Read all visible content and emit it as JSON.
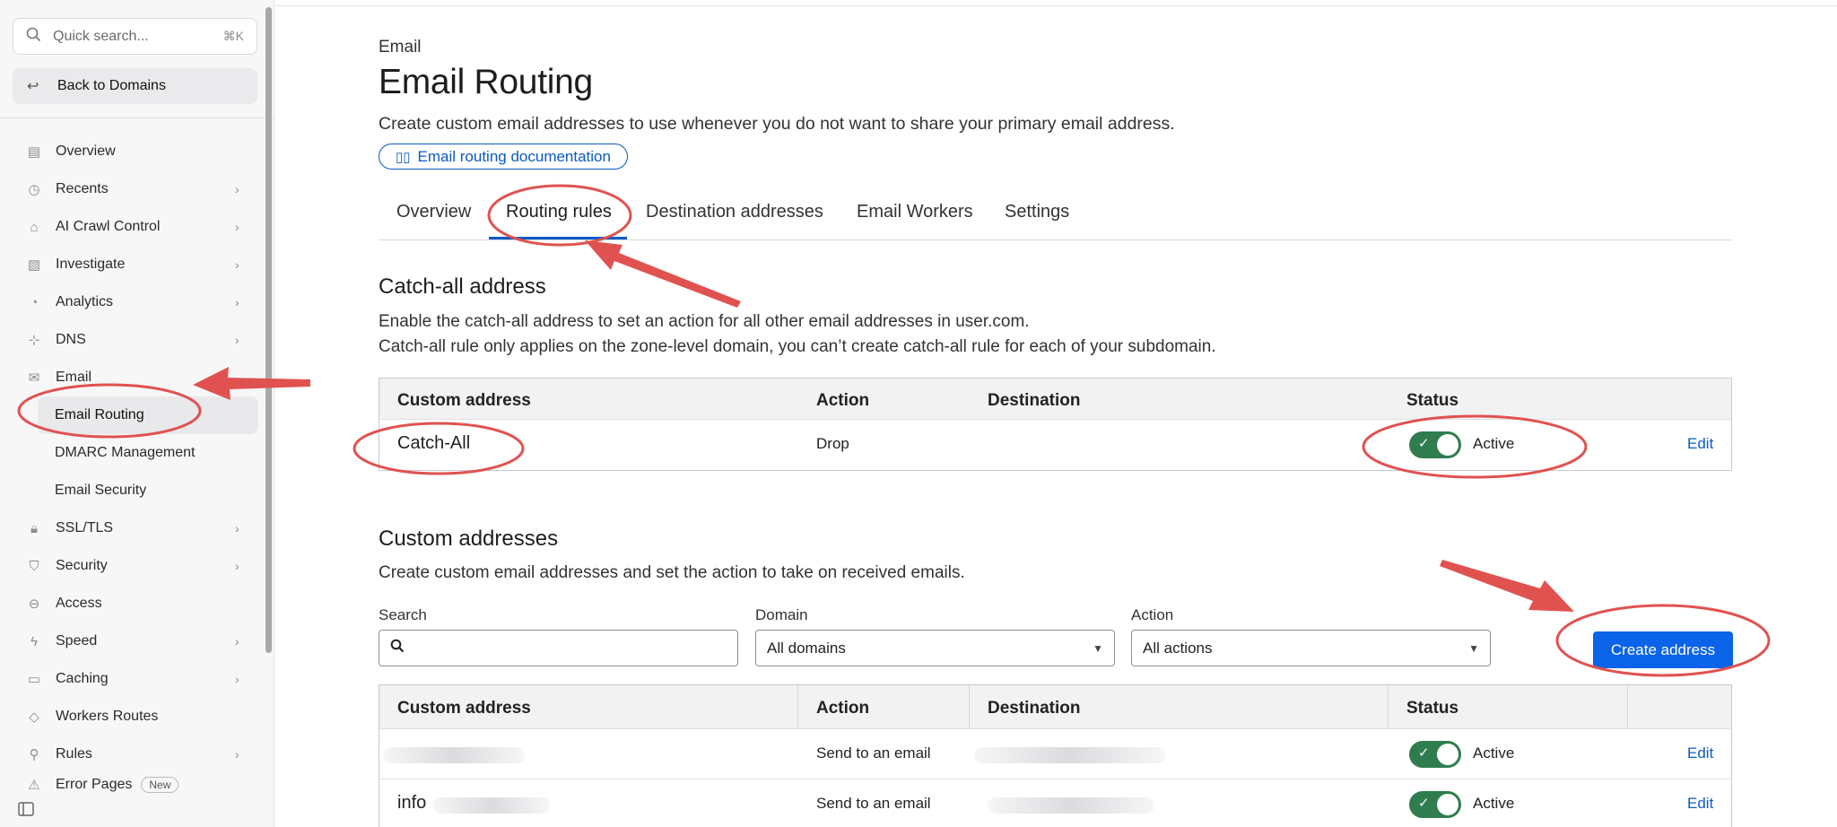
{
  "sidebar": {
    "search": {
      "placeholder": "Quick search...",
      "shortcut": "⌘K"
    },
    "back_label": "Back to Domains",
    "items": [
      {
        "label": "Overview",
        "icon": "document-icon",
        "chevron": false
      },
      {
        "label": "Recents",
        "icon": "history-icon",
        "chevron": true
      },
      {
        "label": "AI Crawl Control",
        "icon": "robot-icon",
        "chevron": true
      },
      {
        "label": "Investigate",
        "icon": "investigate-icon",
        "chevron": true
      },
      {
        "label": "Analytics",
        "icon": "analytics-icon",
        "chevron": true
      },
      {
        "label": "DNS",
        "icon": "network-icon",
        "chevron": true
      },
      {
        "label": "Email",
        "icon": "mail-icon",
        "chevron": "down"
      }
    ],
    "email_sub": [
      {
        "label": "Email Routing",
        "active": true
      },
      {
        "label": "DMARC Management",
        "active": false
      },
      {
        "label": "Email Security",
        "active": false
      }
    ],
    "items_after": [
      {
        "label": "SSL/TLS",
        "icon": "lock-icon",
        "chevron": true
      },
      {
        "label": "Security",
        "icon": "shield-icon",
        "chevron": true
      },
      {
        "label": "Access",
        "icon": "access-icon",
        "chevron": false
      },
      {
        "label": "Speed",
        "icon": "lightning-icon",
        "chevron": true
      },
      {
        "label": "Caching",
        "icon": "storage-icon",
        "chevron": true
      },
      {
        "label": "Workers Routes",
        "icon": "workers-icon",
        "chevron": false
      },
      {
        "label": "Rules",
        "icon": "rules-icon",
        "chevron": true
      },
      {
        "label": "Error Pages",
        "icon": "error-icon",
        "chevron": false,
        "badge": "New"
      }
    ]
  },
  "header": {
    "eyebrow": "Email",
    "title": "Email Routing",
    "subtitle": "Create custom email addresses to use whenever you do not want to share your primary email address.",
    "doc_link": "Email routing documentation"
  },
  "tabs": [
    "Overview",
    "Routing rules",
    "Destination addresses",
    "Email Workers",
    "Settings"
  ],
  "catch_all": {
    "heading": "Catch-all address",
    "desc1": "Enable the catch-all address to set an action for all other email addresses in user.com.",
    "desc2": "Catch-all rule only applies on the zone-level domain, you can’t create catch-all rule for each of your subdomain.",
    "columns": [
      "Custom address",
      "Action",
      "Destination",
      "Status"
    ],
    "row": {
      "address": "Catch-All",
      "action": "Drop",
      "destination": "",
      "status": "Active",
      "edit": "Edit"
    }
  },
  "custom": {
    "heading": "Custom addresses",
    "desc": "Create custom email addresses and set the action to take on received emails.",
    "filters": {
      "search_label": "Search",
      "domain_label": "Domain",
      "domain_value": "All domains",
      "action_label": "Action",
      "action_value": "All actions"
    },
    "create_button": "Create address",
    "columns": [
      "Custom address",
      "Action",
      "Destination",
      "Status"
    ],
    "rows": [
      {
        "address": "",
        "action": "Send to an email",
        "status": "Active",
        "edit": "Edit"
      },
      {
        "address": "info",
        "action": "Send to an email",
        "status": "Active",
        "edit": "Edit"
      }
    ]
  },
  "colors": {
    "accent": "#0a59c9",
    "toggle_on": "#2f7d4f",
    "annotation": "#e0524f"
  }
}
